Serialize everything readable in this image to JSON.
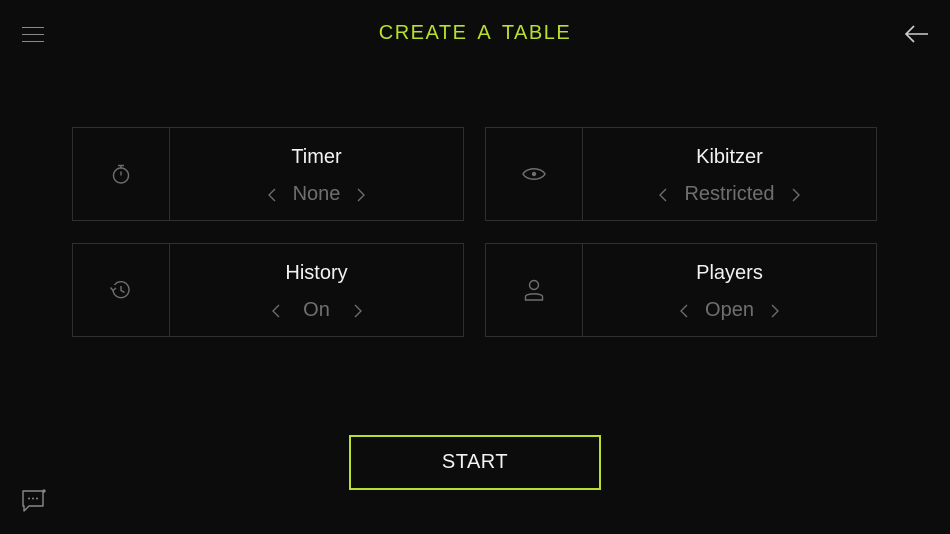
{
  "header": {
    "title": "CREATE  A TABLE",
    "accent_color": "#b9e02c",
    "menu_icon": "hamburger-menu-icon",
    "back_icon": "arrow-left-icon"
  },
  "settings": [
    {
      "key": "timer",
      "label": "Timer",
      "value": "None",
      "icon": "stopwatch-icon"
    },
    {
      "key": "kibitzer",
      "label": "Kibitzer",
      "value": "Restricted",
      "icon": "eye-icon"
    },
    {
      "key": "history",
      "label": "History",
      "value": "On",
      "icon": "history-icon"
    },
    {
      "key": "players",
      "label": "Players",
      "value": "Open",
      "icon": "person-icon"
    }
  ],
  "actions": {
    "start_label": "START"
  },
  "footer": {
    "chat_icon": "chat-icon"
  }
}
